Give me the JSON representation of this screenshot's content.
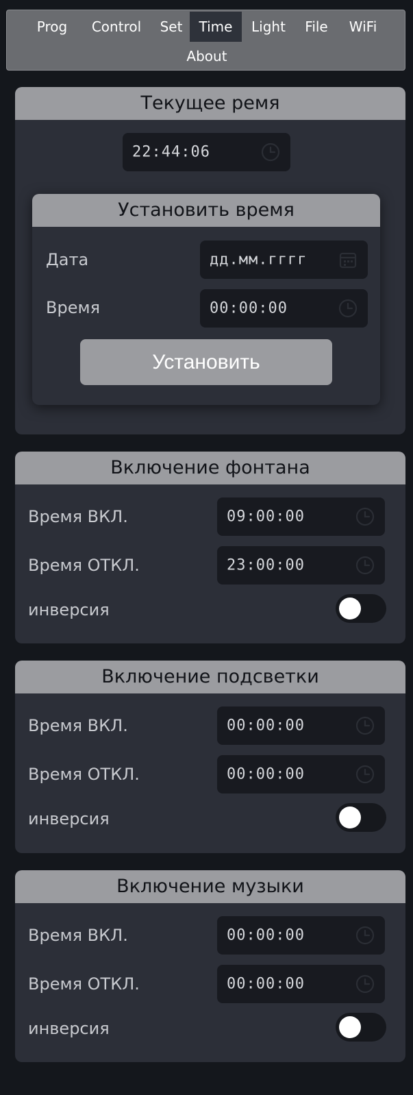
{
  "nav": {
    "items": [
      "Prog",
      "Control",
      "Set",
      "Time",
      "Light",
      "File",
      "WiFi",
      "About"
    ],
    "active": "Time"
  },
  "current_time": {
    "title": "Текущее ремя",
    "value": "22:44:06"
  },
  "set_time": {
    "title": "Установить время",
    "date_label": "Дата",
    "date_placeholder": "дд.мм.гггг",
    "time_label": "Время",
    "time_value": "00:00:00",
    "button_label": "Установить"
  },
  "fountain": {
    "title": "Включение фонтана",
    "on_label": "Время ВКЛ.",
    "on_value": "09:00:00",
    "off_label": "Время ОТКЛ.",
    "off_value": "23:00:00",
    "inversion_label": "инверсия",
    "inversion_on": false
  },
  "backlight": {
    "title": "Включение подсветки",
    "on_label": "Время ВКЛ.",
    "on_value": "00:00:00",
    "off_label": "Время ОТКЛ.",
    "off_value": "00:00:00",
    "inversion_label": "инверсия",
    "inversion_on": false
  },
  "music": {
    "title": "Включение музыки",
    "on_label": "Время ВКЛ.",
    "on_value": "00:00:00",
    "off_label": "Время ОТКЛ.",
    "off_value": "00:00:00",
    "inversion_label": "инверсия",
    "inversion_on": false
  },
  "icons": {
    "clock": "clock-icon",
    "calendar": "calendar-icon"
  },
  "colors": {
    "background": "#14171c",
    "nav_bg": "#6a6c70",
    "nav_active": "#2e323a",
    "card_bg": "#2c2f38",
    "card_header": "#9b9ca0",
    "input_bg": "#181a20"
  }
}
